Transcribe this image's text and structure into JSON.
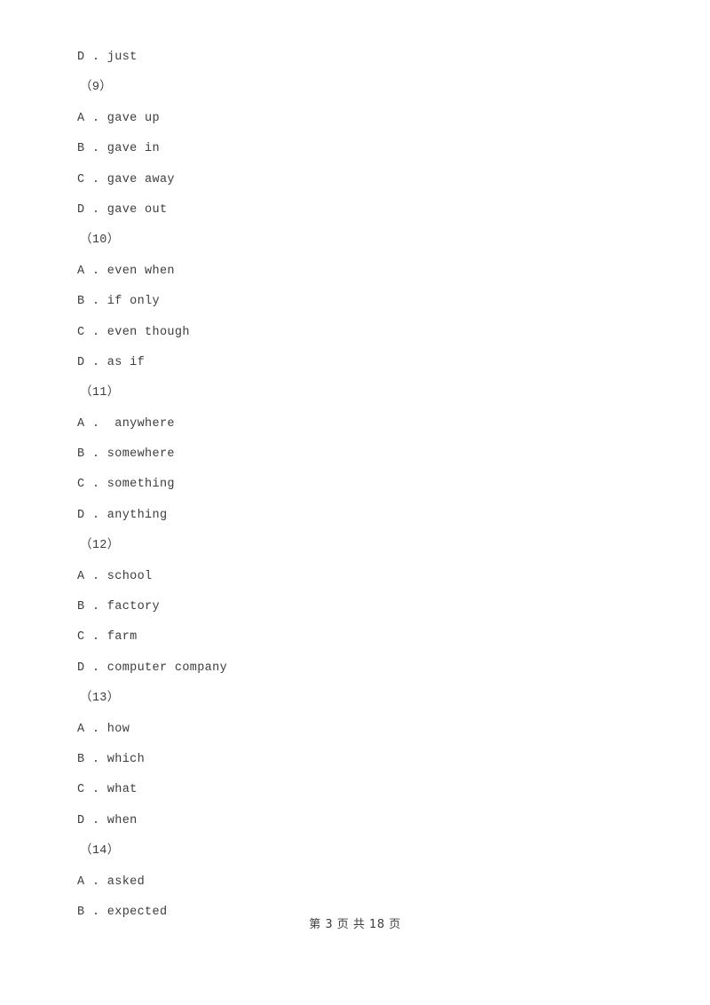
{
  "document": {
    "lines": [
      {
        "kind": "option",
        "text": "D . just"
      },
      {
        "kind": "qnum",
        "text": "（9）"
      },
      {
        "kind": "option",
        "text": "A . gave up"
      },
      {
        "kind": "option",
        "text": "B . gave in"
      },
      {
        "kind": "option",
        "text": "C . gave away"
      },
      {
        "kind": "option",
        "text": "D . gave out"
      },
      {
        "kind": "qnum",
        "text": "（10）"
      },
      {
        "kind": "option",
        "text": "A . even when"
      },
      {
        "kind": "option",
        "text": "B . if only"
      },
      {
        "kind": "option",
        "text": "C . even though"
      },
      {
        "kind": "option",
        "text": "D . as if"
      },
      {
        "kind": "qnum",
        "text": "（11）"
      },
      {
        "kind": "option",
        "text": "A .  anywhere"
      },
      {
        "kind": "option",
        "text": "B . somewhere"
      },
      {
        "kind": "option",
        "text": "C . something"
      },
      {
        "kind": "option",
        "text": "D . anything"
      },
      {
        "kind": "qnum",
        "text": "（12）"
      },
      {
        "kind": "option",
        "text": "A . school"
      },
      {
        "kind": "option",
        "text": "B . factory"
      },
      {
        "kind": "option",
        "text": "C . farm"
      },
      {
        "kind": "option",
        "text": "D . computer company"
      },
      {
        "kind": "qnum",
        "text": "（13）"
      },
      {
        "kind": "option",
        "text": "A . how"
      },
      {
        "kind": "option",
        "text": "B . which"
      },
      {
        "kind": "option",
        "text": "C . what"
      },
      {
        "kind": "option",
        "text": "D . when"
      },
      {
        "kind": "qnum",
        "text": "（14）"
      },
      {
        "kind": "option",
        "text": "A . asked"
      },
      {
        "kind": "option",
        "text": "B . expected"
      }
    ]
  },
  "footer": {
    "text": "第 3 页 共 18 页",
    "current_page": "3",
    "total_pages": "18"
  },
  "colors": {
    "text": "#3d3d3d",
    "background": "#ffffff"
  }
}
